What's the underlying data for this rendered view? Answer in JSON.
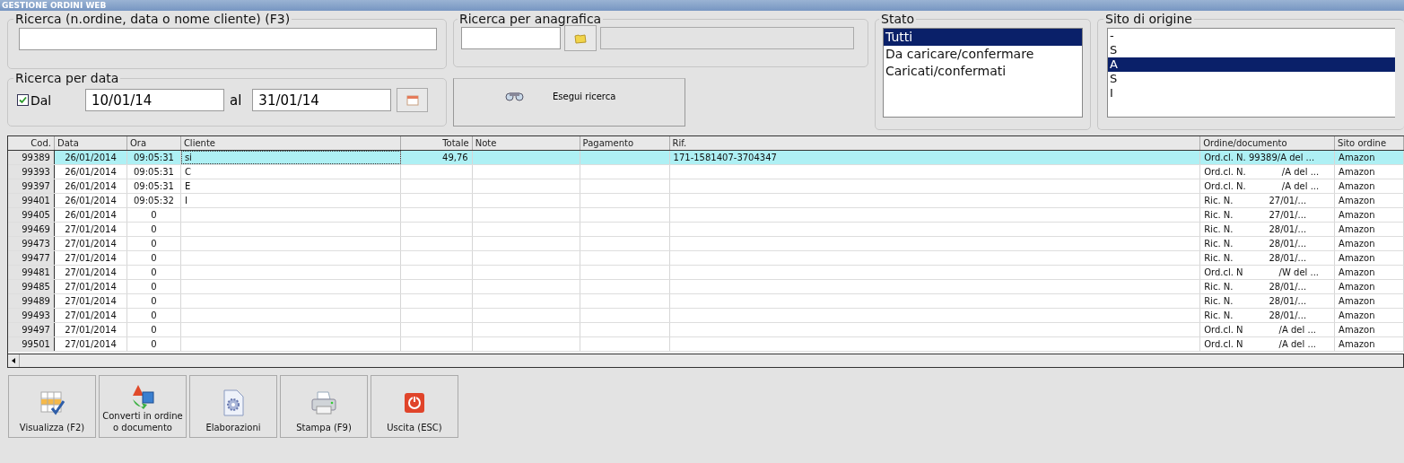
{
  "window": {
    "title": "GESTIONE ORDINI WEB"
  },
  "search": {
    "legend": "Ricerca (n.ordine, data o nome cliente) (F3)"
  },
  "registry_search": {
    "legend": "Ricerca per anagrafica"
  },
  "date_search": {
    "legend": "Ricerca per data",
    "checkbox_label": "Dal",
    "checked": true,
    "from": "10/01/14",
    "to_label": "al",
    "to": "31/01/14"
  },
  "run_button": {
    "label": "Esegui ricerca"
  },
  "status": {
    "legend": "Stato",
    "items": [
      {
        "label": "Tutti",
        "selected": true
      },
      {
        "label": "Da caricare/confermare",
        "selected": false
      },
      {
        "label": "Caricati/confermati",
        "selected": false
      }
    ]
  },
  "origin_site": {
    "legend": "Sito di origine",
    "items": [
      {
        "label": "-",
        "selected": false
      },
      {
        "label": "S",
        "selected": false
      },
      {
        "label": "A",
        "selected": true
      },
      {
        "label": "S",
        "selected": false
      },
      {
        "label": "I",
        "selected": false
      }
    ]
  },
  "table": {
    "columns": [
      "Cod.",
      "Data",
      "Ora",
      "Cliente",
      "Totale",
      "Note",
      "Pagamento",
      "Rif.",
      "Ordine/documento",
      "Sito ordine"
    ],
    "rows": [
      {
        "selected": true,
        "cells": [
          "99389",
          "26/01/2014",
          "09:05:31",
          "si",
          "49,76",
          "",
          "",
          "171-1581407-3704347",
          "Ord.cl. N. 99389/A del ...",
          "Amazon"
        ]
      },
      {
        "selected": false,
        "cells": [
          "99393",
          "26/01/2014",
          "09:05:31",
          "C",
          "",
          "",
          "",
          "",
          "Ord.cl. N.",
          "Amazon"
        ],
        "order_tail": "/A del ..."
      },
      {
        "selected": false,
        "cells": [
          "99397",
          "26/01/2014",
          "09:05:31",
          "E",
          "",
          "",
          "",
          "",
          "Ord.cl. N.",
          "Amazon"
        ],
        "order_tail": "/A del ..."
      },
      {
        "selected": false,
        "cells": [
          "99401",
          "26/01/2014",
          "09:05:32",
          "I",
          "",
          "",
          "",
          "",
          "Ric. N.",
          "Amazon"
        ],
        "order_tail": "27/01/..."
      },
      {
        "selected": false,
        "cells": [
          "99405",
          "26/01/2014",
          "0",
          "",
          "",
          "",
          "",
          "",
          "Ric. N.",
          "Amazon"
        ],
        "order_tail": "27/01/..."
      },
      {
        "selected": false,
        "cells": [
          "99469",
          "27/01/2014",
          "0",
          "",
          "",
          "",
          "",
          "",
          "Ric. N.",
          "Amazon"
        ],
        "order_tail": "28/01/..."
      },
      {
        "selected": false,
        "cells": [
          "99473",
          "27/01/2014",
          "0",
          "",
          "",
          "",
          "",
          "",
          "Ric. N.",
          "Amazon"
        ],
        "order_tail": "28/01/..."
      },
      {
        "selected": false,
        "cells": [
          "99477",
          "27/01/2014",
          "0",
          "",
          "",
          "",
          "",
          "",
          "Ric. N.",
          "Amazon"
        ],
        "order_tail": "28/01/..."
      },
      {
        "selected": false,
        "cells": [
          "99481",
          "27/01/2014",
          "0",
          "",
          "",
          "",
          "",
          "",
          "Ord.cl. N",
          "Amazon"
        ],
        "order_tail": "/W del ..."
      },
      {
        "selected": false,
        "cells": [
          "99485",
          "27/01/2014",
          "0",
          "",
          "",
          "",
          "",
          "",
          "Ric. N.",
          "Amazon"
        ],
        "order_tail": "28/01/..."
      },
      {
        "selected": false,
        "cells": [
          "99489",
          "27/01/2014",
          "0",
          "",
          "",
          "",
          "",
          "",
          "Ric. N.",
          "Amazon"
        ],
        "order_tail": "28/01/..."
      },
      {
        "selected": false,
        "cells": [
          "99493",
          "27/01/2014",
          "0",
          "",
          "",
          "",
          "",
          "",
          "Ric. N.",
          "Amazon"
        ],
        "order_tail": "28/01/..."
      },
      {
        "selected": false,
        "cells": [
          "99497",
          "27/01/2014",
          "0",
          "",
          "",
          "",
          "",
          "",
          "Ord.cl. N",
          "Amazon"
        ],
        "order_tail": "/A del ..."
      },
      {
        "selected": false,
        "cells": [
          "99501",
          "27/01/2014",
          "0",
          "",
          "",
          "",
          "",
          "",
          "Ord.cl. N",
          "Amazon"
        ],
        "order_tail": "/A del ..."
      }
    ]
  },
  "toolbar": [
    {
      "kind": "view",
      "label": "Visualizza (F2)"
    },
    {
      "kind": "convert",
      "label": "Converti in ordine o documento"
    },
    {
      "kind": "process",
      "label": "Elaborazioni"
    },
    {
      "kind": "print",
      "label": "Stampa (F9)"
    },
    {
      "kind": "exit",
      "label": "Uscita (ESC)"
    }
  ]
}
